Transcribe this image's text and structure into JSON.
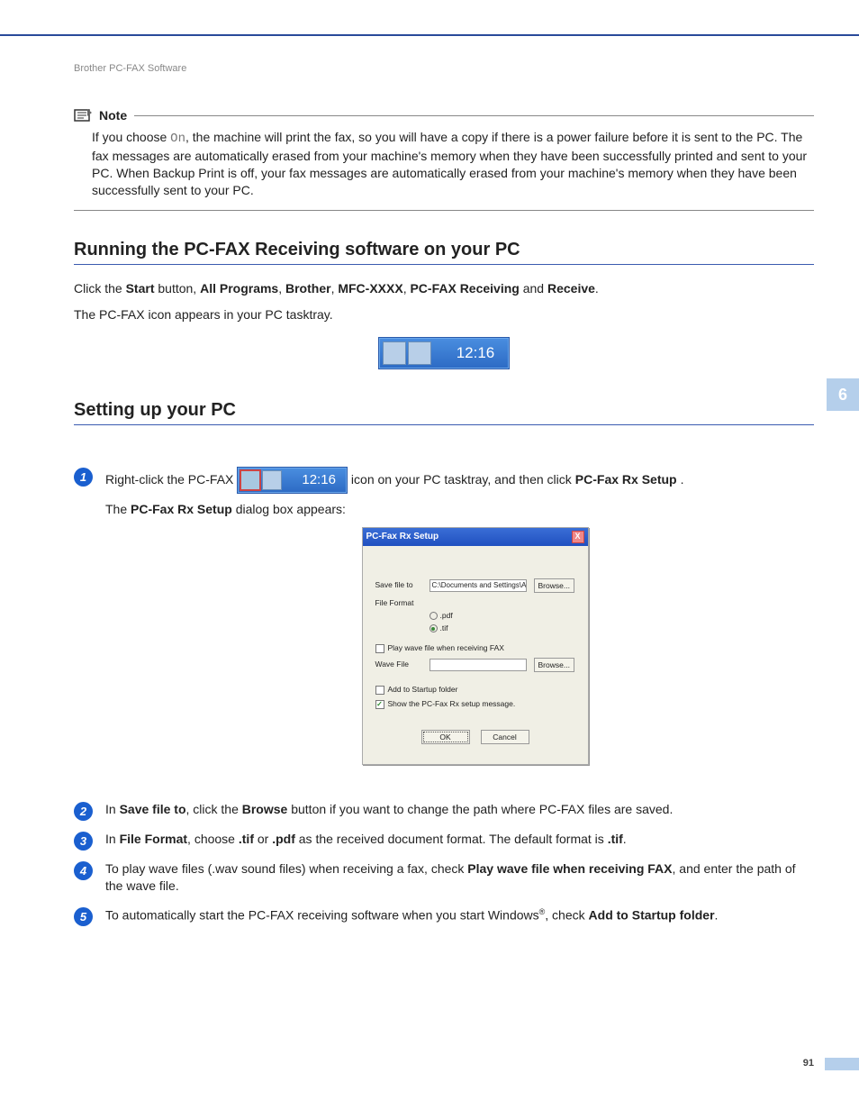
{
  "breadcrumb": "Brother PC-FAX Software",
  "chapter_tab": "6",
  "page_number": "91",
  "note": {
    "title": "Note",
    "text_parts": {
      "p1": "If you choose ",
      "mono": "On",
      "p2": ", the machine will print the fax, so you will have a copy if there is a power failure before it is sent to the PC. The fax messages are automatically erased from your machine's memory when they have been successfully printed and sent to your PC. When Backup Print is off, your fax messages are automatically erased from your machine's memory when they have been successfully sent to your PC."
    }
  },
  "section1": {
    "heading": "Running the PC-FAX Receiving software on your PC",
    "para1": {
      "t1": "Click the ",
      "b1": "Start",
      "t2": " button, ",
      "b2": "All Programs",
      "t3": ", ",
      "b3": "Brother",
      "t4": ", ",
      "b4": "MFC-XXXX",
      "t5": ", ",
      "b5": "PC-FAX Receiving",
      "t6": " and ",
      "b6": "Receive",
      "t7": "."
    },
    "para2": "The PC-FAX icon appears in your PC tasktray.",
    "tasktray_time": "12:16"
  },
  "section2": {
    "heading": "Setting up your PC",
    "steps": {
      "s1": {
        "num": "1",
        "pre": "Right-click the PC-FAX",
        "tray_time": "12:16",
        "mid": " icon on your PC tasktray, and then click ",
        "bold1": "PC-Fax Rx Setup",
        "tail": ".",
        "line2a": "The ",
        "line2b": "PC-Fax Rx Setup",
        "line2c": " dialog box appears:"
      },
      "s2": {
        "num": "2",
        "t1": "In ",
        "b1": "Save file to",
        "t2": ", click the ",
        "b2": "Browse",
        "t3": " button if you want to change the path where PC-FAX files are saved."
      },
      "s3": {
        "num": "3",
        "t1": "In ",
        "b1": "File Format",
        "t2": ", choose ",
        "b2": ".tif",
        "t3": " or ",
        "b3": ".pdf",
        "t4": " as the received document format. The default format is ",
        "b4": ".tif",
        "t5": "."
      },
      "s4": {
        "num": "4",
        "t1": "To play wave files (.wav sound files) when receiving a fax, check ",
        "b1": "Play wave file when receiving FAX",
        "t2": ", and enter the path of the wave file."
      },
      "s5": {
        "num": "5",
        "t1": "To automatically start the PC-FAX receiving software when you start Windows",
        "sup": "®",
        "t2": ", check ",
        "b1": "Add to Startup folder",
        "t3": "."
      }
    },
    "dialog": {
      "title": "PC-Fax Rx Setup",
      "close": "X",
      "save_label": "Save file to",
      "save_value": "C:\\Documents and Settings\\All Use",
      "browse": "Browse...",
      "format_label": "File Format",
      "opt_pdf": ".pdf",
      "opt_tif": ".tif",
      "play_wave": "Play wave file when receiving FAX",
      "wave_label": "Wave File",
      "add_startup": "Add to Startup folder",
      "show_msg": "Show the PC-Fax Rx setup message.",
      "ok": "OK",
      "cancel": "Cancel"
    }
  }
}
